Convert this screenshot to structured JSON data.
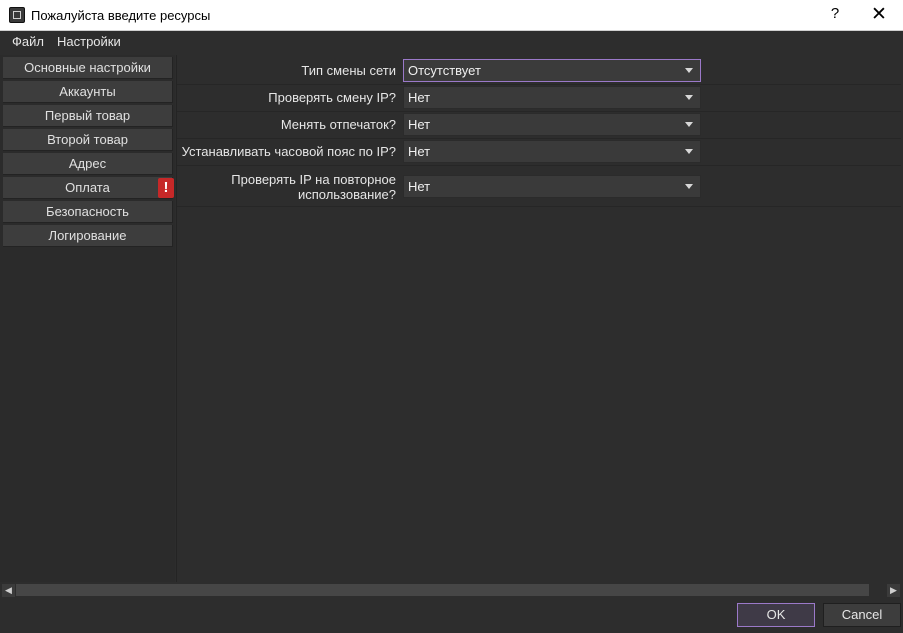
{
  "window": {
    "title": "Пожалуйста введите ресурсы",
    "help_label": "?",
    "close_label": "✕"
  },
  "menu": [
    "Файл",
    "Настройки"
  ],
  "sidebar": {
    "items": [
      {
        "label": "Основные настройки"
      },
      {
        "label": "Аккаунты"
      },
      {
        "label": "Первый товар"
      },
      {
        "label": "Второй товар"
      },
      {
        "label": "Адрес"
      },
      {
        "label": "Оплата",
        "alert": "!"
      },
      {
        "label": "Безопасность"
      },
      {
        "label": "Логирование"
      }
    ]
  },
  "form": {
    "rows": [
      {
        "label": "Тип смены сети",
        "value": "Отсутствует"
      },
      {
        "label": "Проверять смену IP?",
        "value": "Нет"
      },
      {
        "label": "Менять отпечаток?",
        "value": "Нет"
      },
      {
        "label": "Устанавливать часовой пояс по IP?",
        "value": "Нет"
      },
      {
        "label_line1": "Проверять IP на повторное",
        "label_line2": "использование?",
        "value": "Нет"
      }
    ]
  },
  "scrollbar": {
    "left_arrow": "◀",
    "right_arrow": "▶"
  },
  "buttons": {
    "ok": "OK",
    "cancel": "Cancel"
  },
  "colors": {
    "accent": "#9b79c9",
    "alert": "#c62828",
    "background": "#2d2d2d"
  }
}
